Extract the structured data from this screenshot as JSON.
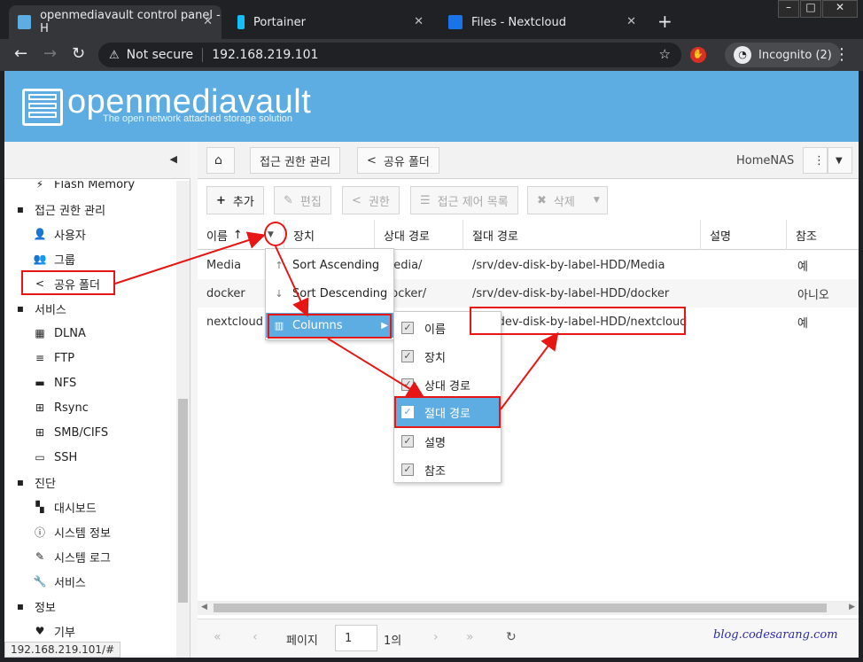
{
  "browser": {
    "tabs": [
      {
        "title": "openmediavault control panel - H",
        "active": true
      },
      {
        "title": "Portainer",
        "active": false
      },
      {
        "title": "Files - Nextcloud",
        "active": false
      }
    ],
    "address": {
      "security": "Not secure",
      "url": "192.168.219.101"
    },
    "profile": "Incognito (2)",
    "status_url": "192.168.219.101/#"
  },
  "app": {
    "title": "openmediavault",
    "subtitle": "The open network attached storage solution",
    "hostname": "HomeNAS"
  },
  "sidebar": {
    "items": [
      {
        "label": "Flash Memory",
        "icon": "flash-icon",
        "group": false
      },
      {
        "label": "접근 권한 관리",
        "icon": "minus-square-icon",
        "group": true
      },
      {
        "label": "사용자",
        "icon": "user-icon",
        "group": false
      },
      {
        "label": "그룹",
        "icon": "users-icon",
        "group": false
      },
      {
        "label": "공유 폴더",
        "icon": "share-icon",
        "group": false
      },
      {
        "label": "서비스",
        "icon": "minus-square-icon",
        "group": true
      },
      {
        "label": "DLNA",
        "icon": "film-icon",
        "group": false
      },
      {
        "label": "FTP",
        "icon": "server-icon",
        "group": false
      },
      {
        "label": "NFS",
        "icon": "desktop-icon",
        "group": false
      },
      {
        "label": "Rsync",
        "icon": "sitemap-icon",
        "group": false
      },
      {
        "label": "SMB/CIFS",
        "icon": "windows-icon",
        "group": false
      },
      {
        "label": "SSH",
        "icon": "terminal-icon",
        "group": false
      },
      {
        "label": "진단",
        "icon": "minus-square-icon",
        "group": true
      },
      {
        "label": "대시보드",
        "icon": "dashboard-icon",
        "group": false
      },
      {
        "label": "시스템 정보",
        "icon": "info-icon",
        "group": false
      },
      {
        "label": "시스템 로그",
        "icon": "edit-icon",
        "group": false
      },
      {
        "label": "서비스",
        "icon": "wrench-icon",
        "group": false
      },
      {
        "label": "정보",
        "icon": "minus-square-icon",
        "group": true
      },
      {
        "label": "기부",
        "icon": "heart-icon",
        "group": false
      }
    ]
  },
  "breadcrumb": {
    "home": "home-icon",
    "level1": "접근 권한 관리",
    "level2": "공유 폴더"
  },
  "toolbar": {
    "add": "추가",
    "edit": "편집",
    "privileges": "권한",
    "acl": "접근 제어 목록",
    "delete": "삭제"
  },
  "grid": {
    "columns": [
      "이름",
      "장치",
      "상대 경로",
      "절대 경로",
      "설명",
      "참조"
    ],
    "rows": [
      {
        "name": "Media",
        "device": "",
        "relpath": "Media/",
        "abspath": "/srv/dev-disk-by-label-HDD/Media",
        "desc": "",
        "ref": "예"
      },
      {
        "name": "docker",
        "device": "",
        "relpath": "docker/",
        "abspath": "/srv/dev-disk-by-label-HDD/docker",
        "desc": "",
        "ref": "아니오"
      },
      {
        "name": "nextcloud",
        "device": "",
        "relpath": "",
        "abspath": "/srv/dev-disk-by-label-HDD/nextcloud",
        "desc": "",
        "ref": "예"
      }
    ]
  },
  "column_menu": {
    "sort_asc": "Sort Ascending",
    "sort_desc": "Sort Descending",
    "columns": "Columns"
  },
  "columns_submenu": [
    "이름",
    "장치",
    "상대 경로",
    "절대 경로",
    "설명",
    "참조"
  ],
  "pager": {
    "page_label": "페이지",
    "page": "1",
    "of": "1의"
  },
  "watermark": "blog.codesarang.com",
  "colors": {
    "accent": "#5dade2",
    "highlight": "#e81515"
  }
}
